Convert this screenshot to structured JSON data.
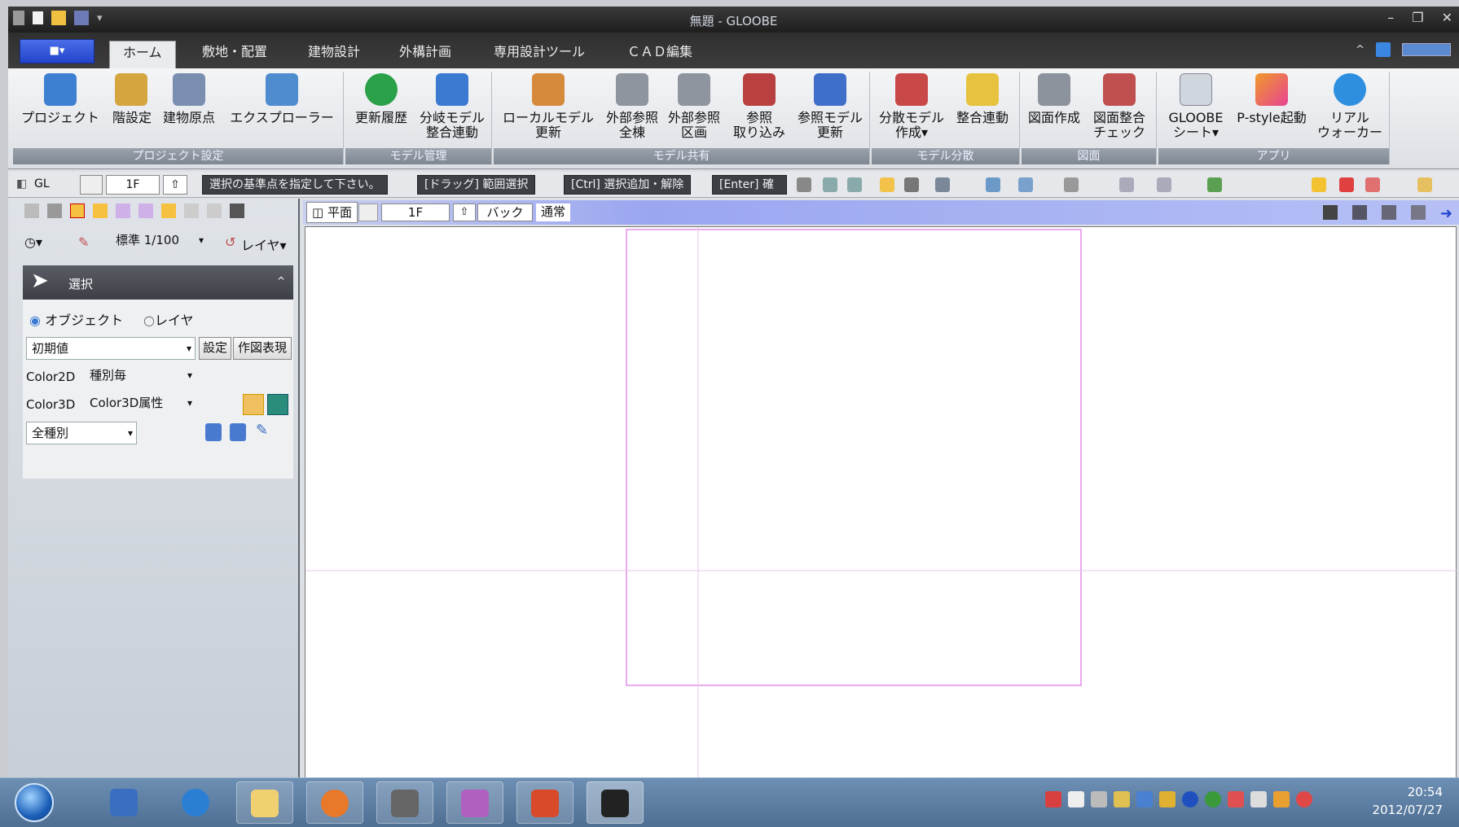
{
  "window": {
    "title": "無題 - GLOOBE"
  },
  "tabs": {
    "file": "■▾",
    "home": "ホーム",
    "site": "敷地・配置",
    "building": "建物設計",
    "exterior": "外構計画",
    "tools": "専用設計ツール",
    "cad": "ＣＡＤ編集"
  },
  "ribbon": {
    "groups": {
      "project": "プロジェクト設定",
      "model_mgmt": "モデル管理",
      "model_share": "モデル共有",
      "model_dist": "モデル分散",
      "drawing": "図面",
      "apps": "アプリ"
    },
    "buttons": {
      "project": "プロジェクト",
      "floor": "階設定",
      "origin": "建物原点",
      "explorer": "エクスプローラー",
      "history": "更新履歴",
      "branch": "分岐モデル\n整合連動",
      "local": "ローカルモデル\n更新",
      "extref_all": "外部参照\n全棟",
      "extref_area": "外部参照\n区画",
      "ref_import": "参照\n取り込み",
      "ref_update": "参照モデル\n更新",
      "dist_create": "分散モデル\n作成▾",
      "sync": "整合連動",
      "draw_make": "図面作成",
      "draw_check": "図面整合\nチェック",
      "gloobe_sheet": "GLOOBE\nシート▾",
      "pstyle": "P-style起動",
      "walker": "リアル\nウォーカー"
    }
  },
  "cmdbar": {
    "gl": "GL",
    "floor": "1F",
    "msg": "選択の基準点を指定して下さい。",
    "drag": "[ドラッグ] 範囲選択",
    "ctrl": "[Ctrl] 選択追加・解除",
    "enter": "[Enter] 確"
  },
  "left": {
    "scale": "標準 1/100",
    "layer": "レイヤ▾",
    "panel_title": "選択",
    "radio_object": "オブジェクト",
    "radio_layer": "レイヤ",
    "preset": "初期値",
    "btn_setting": "設定",
    "btn_expr": "作図表現",
    "color2d_label": "Color2D",
    "color2d_value": "種別毎",
    "color3d_label": "Color3D",
    "color3d_value": "Color3D属性",
    "kind": "全種別"
  },
  "view": {
    "plan": "平面",
    "floor": "1F",
    "back": "バック",
    "normal": "通常"
  },
  "taskbar": {
    "time": "20:54",
    "date": "2012/07/27"
  },
  "colors": {
    "accent": "#2244cc",
    "guide": "#e28ee8"
  }
}
